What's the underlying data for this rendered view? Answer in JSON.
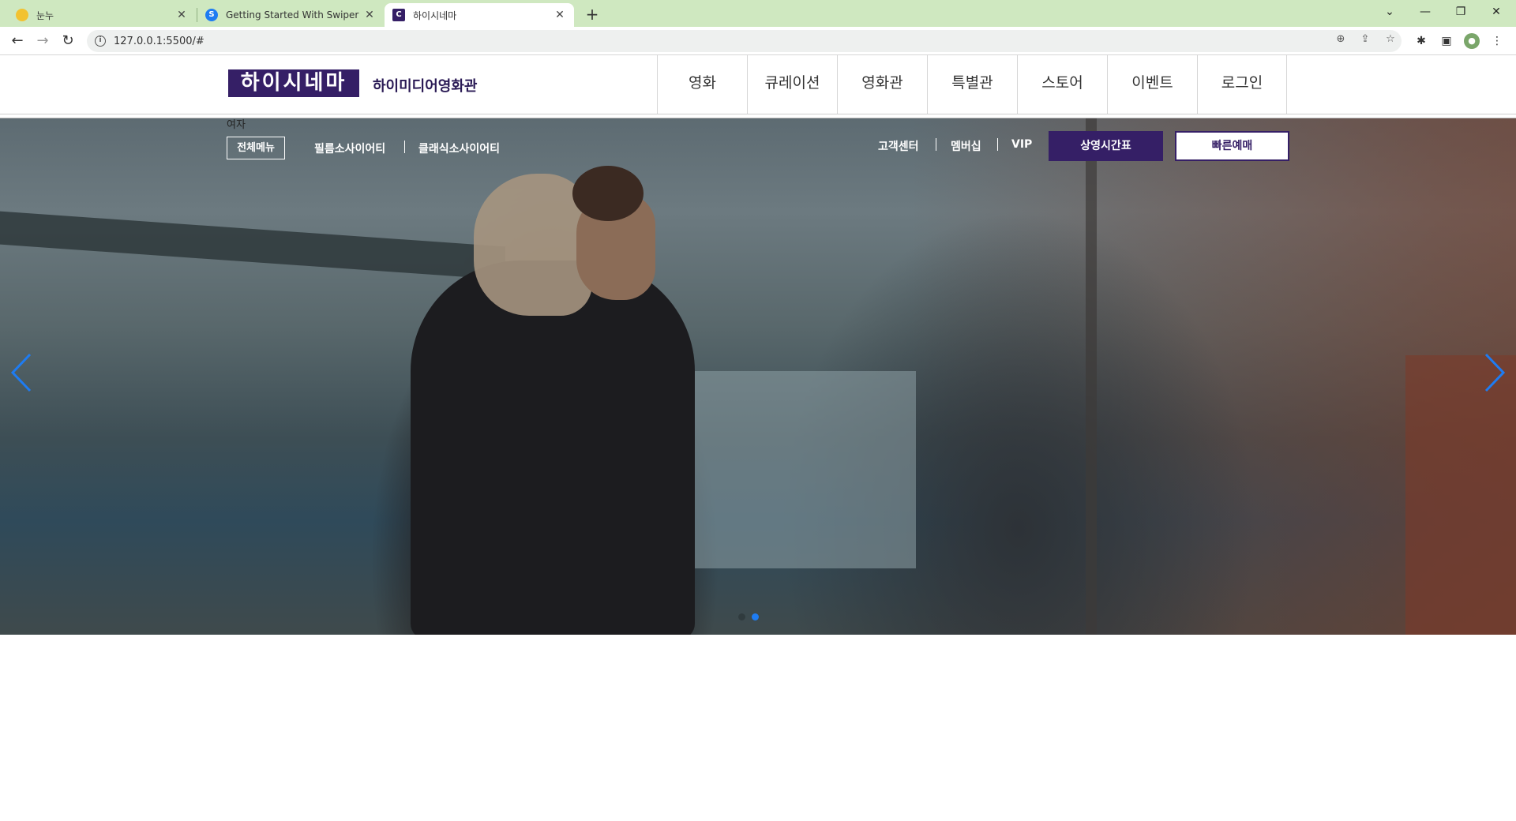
{
  "browser": {
    "tabs": [
      {
        "title": "눈누",
        "favicon": "noonnu-icon",
        "favicon_color": "#f2c230"
      },
      {
        "title": "Getting Started With Swiper",
        "favicon": "swiper-icon",
        "favicon_color": "#1e7cf2"
      },
      {
        "title": "하이시네마",
        "favicon": "c-icon",
        "favicon_color": "#351f66",
        "favicon_letter": "C"
      }
    ],
    "url": "127.0.0.1:5500/#"
  },
  "site": {
    "logo": "하이시네마",
    "logo_sub": "하이미디어영화관",
    "gnb": [
      "영화",
      "큐레이션",
      "영화관",
      "특별관",
      "스토어",
      "이벤트",
      "로그인"
    ],
    "util_text": "여자",
    "all_menu": "전체메뉴",
    "sub_links": [
      "필름소사이어티",
      "클래식소사이어티"
    ],
    "util_links": [
      "고객센터",
      "멤버십",
      "VIP"
    ],
    "btn_schedule": "상영시간표",
    "btn_quick": "빠른예매"
  },
  "slider": {
    "total_slides": 2,
    "active_index": 1,
    "accent_color": "#1e7cf2"
  },
  "colors": {
    "brand": "#351f66",
    "tabbar": "#cfe8c0"
  }
}
